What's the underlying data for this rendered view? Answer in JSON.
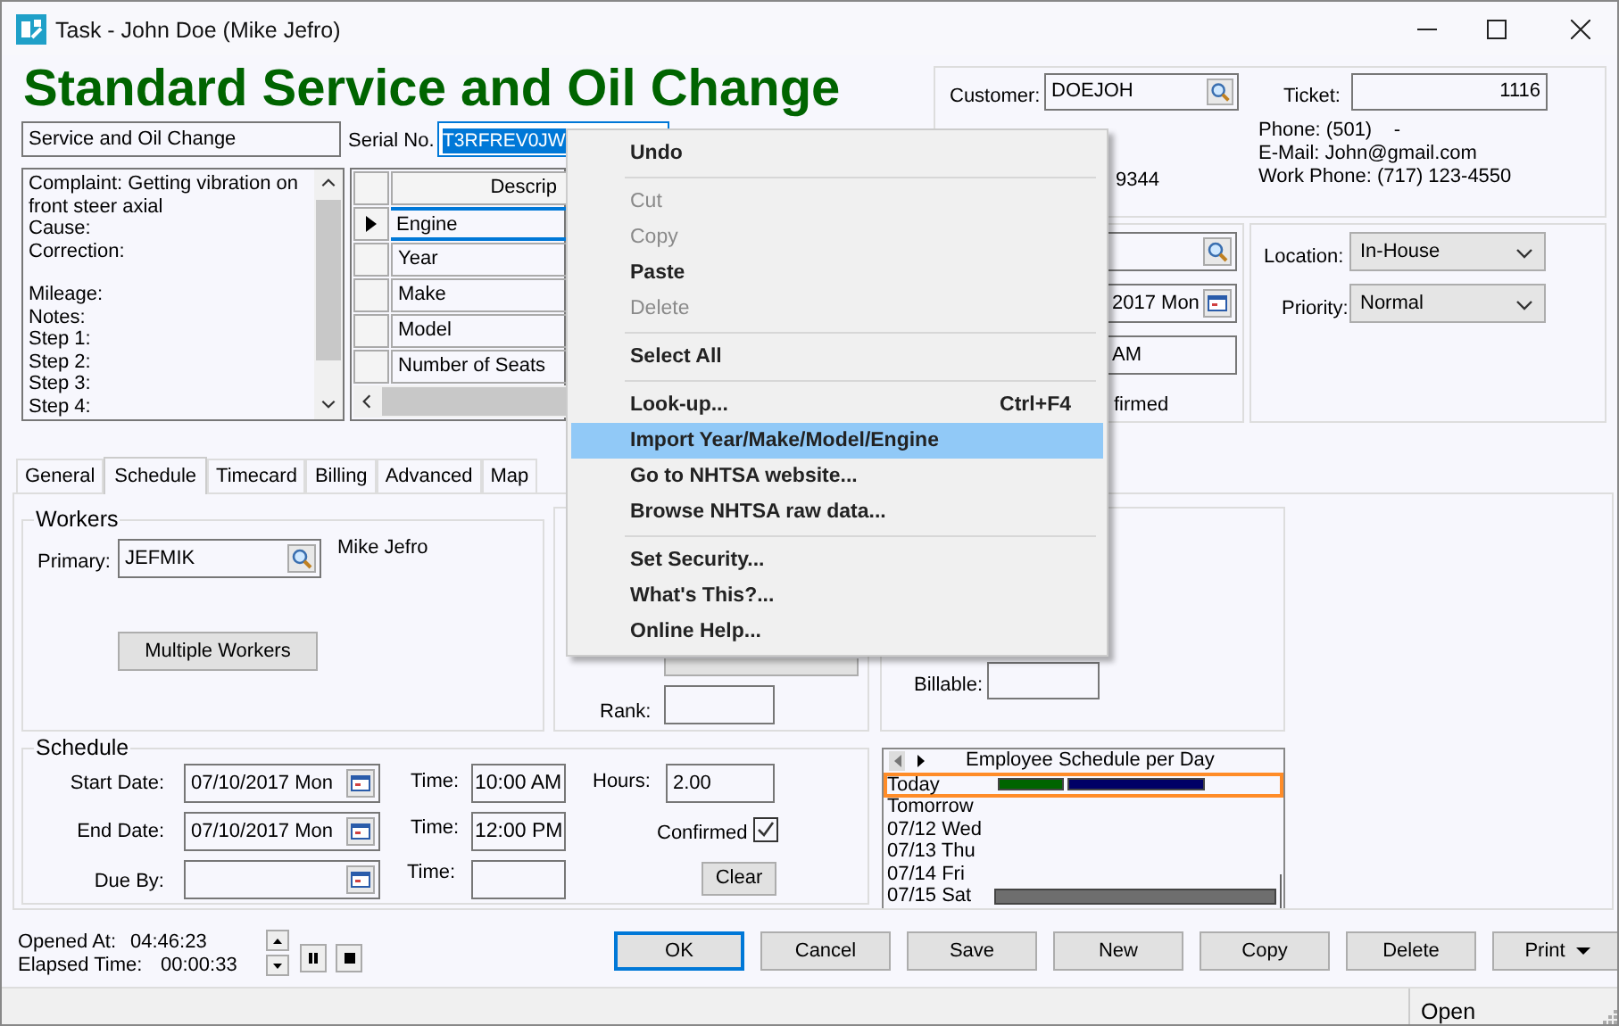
{
  "window": {
    "title": "Task - John Doe (Mike Jefro)"
  },
  "heading": "Standard Service and Oil Change",
  "task_name": "Service and Oil Change",
  "serial": {
    "label": "Serial No.",
    "value": "T3RFREV0JW"
  },
  "notes": [
    [
      "Complaint:  Getting vibration on front steer axial",
      "Cause:",
      "Correction:"
    ],
    [
      "Mileage:",
      "Notes:",
      "Step 1:",
      "Step 2:",
      "Step 3:",
      "Step 4:"
    ]
  ],
  "grid": {
    "header": "Descrip",
    "rows": [
      {
        "label": "Engine",
        "selected": true
      },
      {
        "label": "Year",
        "selected": false
      },
      {
        "label": "Make",
        "selected": false
      },
      {
        "label": "Model",
        "selected": false
      },
      {
        "label": "Number of Seats",
        "selected": false
      }
    ]
  },
  "customer": {
    "label": "Customer:",
    "value": "DOEJOH",
    "ticket_label": "Ticket:",
    "ticket": "1116",
    "phone_fragment": "9344",
    "contact": [
      "Phone: (501)    -",
      "E-Mail: John@gmail.com",
      "Work Phone: (717) 123-4550"
    ]
  },
  "details": {
    "date_fragment": "2017 Mon",
    "time_fragment": "AM",
    "label_fragment": "firmed"
  },
  "location": {
    "label": "Location:",
    "value": "In-House"
  },
  "priority": {
    "label": "Priority:",
    "value": "Normal"
  },
  "tabs": [
    {
      "label": "General",
      "selected": false
    },
    {
      "label": "Schedule",
      "selected": true
    },
    {
      "label": "Timecard",
      "selected": false
    },
    {
      "label": "Billing",
      "selected": false
    },
    {
      "label": "Advanced",
      "selected": false
    },
    {
      "label": "Map",
      "selected": false
    }
  ],
  "workers": {
    "title": "Workers",
    "primary_label": "Primary:",
    "primary": "JEFMIK",
    "worker_name": "Mike Jefro",
    "button": "Multiple Workers"
  },
  "rank": {
    "label": "Rank:"
  },
  "billable": {
    "label": "Billable:"
  },
  "schedule": {
    "title": "Schedule",
    "start_label": "Start Date:",
    "start_date": "07/10/2017 Mon",
    "start_time_label": "Time:",
    "start_time": "10:00 AM",
    "hours_label": "Hours:",
    "hours": "2.00",
    "end_label": "End Date:",
    "end_date": "07/10/2017 Mon",
    "end_time_label": "Time:",
    "end_time": "12:00 PM",
    "confirmed_label": "Confirmed",
    "confirmed": true,
    "due_label": "Due By:",
    "due_time_label": "Time:",
    "clear_button": "Clear"
  },
  "employee_schedule": {
    "title": "Employee Schedule per Day",
    "days": [
      {
        "label": "Today",
        "selected": true,
        "bars": [
          {
            "color": "#006400"
          },
          {
            "color": "#000066"
          }
        ]
      },
      {
        "label": "Tomorrow",
        "selected": false
      },
      {
        "label": "07/12 Wed",
        "selected": false
      },
      {
        "label": "07/13 Thu",
        "selected": false
      },
      {
        "label": "07/14 Fri",
        "selected": false
      },
      {
        "label": "07/15 Sat",
        "selected": false,
        "bars": [
          {
            "color": "#6e6e6e"
          }
        ]
      }
    ]
  },
  "footer": {
    "opened_label": "Opened At:",
    "opened": "04:46:23",
    "elapsed_label": "Elapsed Time:",
    "elapsed": "00:00:33"
  },
  "buttons": [
    {
      "label": "OK",
      "kind": "default"
    },
    {
      "label": "Cancel",
      "kind": "plain"
    },
    {
      "label": "Save",
      "kind": "plain"
    },
    {
      "label": "New",
      "kind": "plain"
    },
    {
      "label": "Copy",
      "kind": "plain"
    },
    {
      "label": "Delete",
      "kind": "plain"
    },
    {
      "label": "Print",
      "kind": "dropdown"
    }
  ],
  "status_bar": {
    "text": "Open"
  },
  "context_menu": [
    {
      "kind": "item",
      "label": "Undo",
      "disabled": false,
      "highlighted": false
    },
    {
      "kind": "separator"
    },
    {
      "kind": "item",
      "label": "Cut",
      "disabled": true,
      "highlighted": false
    },
    {
      "kind": "item",
      "label": "Copy",
      "disabled": true,
      "highlighted": false
    },
    {
      "kind": "item",
      "label": "Paste",
      "disabled": false,
      "highlighted": false
    },
    {
      "kind": "item",
      "label": "Delete",
      "disabled": true,
      "highlighted": false
    },
    {
      "kind": "separator"
    },
    {
      "kind": "item",
      "label": "Select All",
      "disabled": false,
      "highlighted": false
    },
    {
      "kind": "separator"
    },
    {
      "kind": "item",
      "label": "Look-up...",
      "shortcut": "Ctrl+F4",
      "disabled": false,
      "highlighted": false
    },
    {
      "kind": "item",
      "label": "Import Year/Make/Model/Engine",
      "disabled": false,
      "highlighted": true
    },
    {
      "kind": "item",
      "label": "Go to NHTSA website...",
      "disabled": false,
      "highlighted": false
    },
    {
      "kind": "item",
      "label": "Browse NHTSA raw data...",
      "disabled": false,
      "highlighted": false
    },
    {
      "kind": "separator"
    },
    {
      "kind": "item",
      "label": "Set Security...",
      "disabled": false,
      "highlighted": false
    },
    {
      "kind": "item",
      "label": "What's This?...",
      "disabled": false,
      "highlighted": false
    },
    {
      "kind": "item",
      "label": "Online Help...",
      "disabled": false,
      "highlighted": false
    }
  ]
}
